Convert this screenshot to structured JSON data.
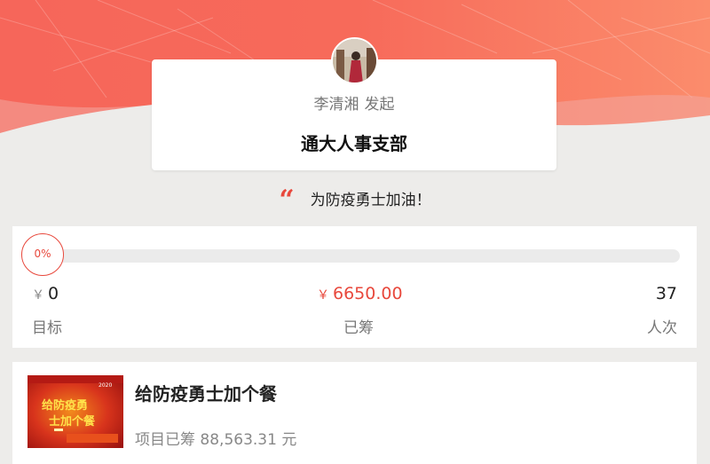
{
  "organizer": {
    "initiator_name": "李清湘",
    "initiator_verb": "发起",
    "org_name": "通大人事支部"
  },
  "slogan": {
    "quote_mark": "“",
    "text": "为防疫勇士加油！"
  },
  "progress": {
    "percent_label": "0%",
    "percent_value": 0,
    "goal": {
      "currency": "￥",
      "value": "0",
      "label": "目标"
    },
    "raised": {
      "currency": "￥",
      "value": "6650.00",
      "label": "已筹"
    },
    "donors": {
      "value": "37",
      "label": "人次"
    }
  },
  "project": {
    "title": "给防疫勇士加个餐",
    "raised_text": "项目已筹 88,563.31 元",
    "thumbnail": {
      "year_text": "2020",
      "line1": "给防疫勇",
      "line2": "士加个餐"
    }
  },
  "colors": {
    "accent": "#e8483c",
    "hero_gradient_start": "#f7685c",
    "hero_gradient_end": "#fb8a6a",
    "page_background": "#edecea"
  }
}
